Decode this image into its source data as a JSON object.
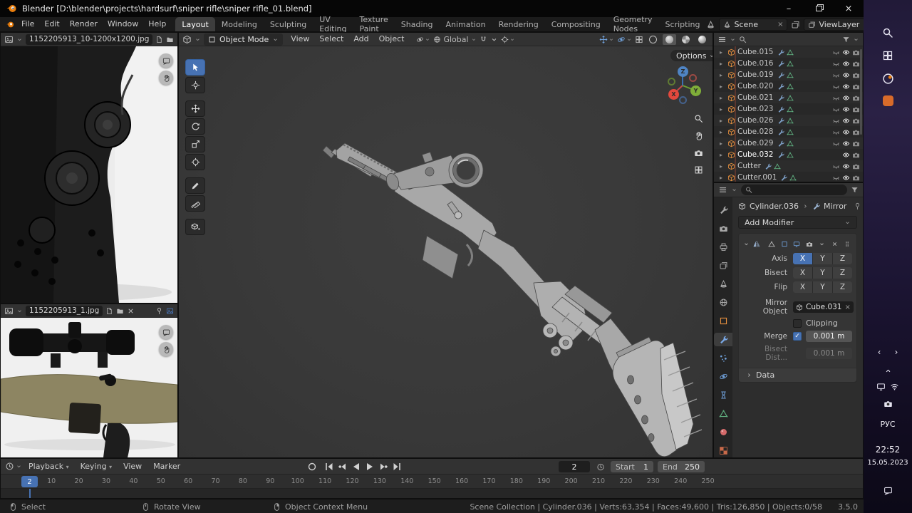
{
  "titlebar": {
    "title": "Blender [D:\\blender\\projects\\hardsurf\\sniper rifle\\sniper rifle_01.blend]"
  },
  "topbar": {
    "menus": [
      "File",
      "Edit",
      "Render",
      "Window",
      "Help"
    ],
    "workspaces": [
      {
        "label": "Layout",
        "cls": "active"
      },
      {
        "label": "Modeling"
      },
      {
        "label": "Sculpting"
      },
      {
        "label": "UV Editing"
      },
      {
        "label": "Texture Paint"
      },
      {
        "label": "Shading"
      },
      {
        "label": "Animation"
      },
      {
        "label": "Rendering"
      },
      {
        "label": "Compositing"
      },
      {
        "label": "Geometry Nodes"
      },
      {
        "label": "Scripting"
      }
    ],
    "scene": "Scene",
    "view_layer": "ViewLayer"
  },
  "image_editor_top": {
    "filename": "1152205913_10-1200x1200.jpg"
  },
  "image_editor_bottom": {
    "filename": "1152205913_1.jpg"
  },
  "viewport": {
    "mode": "Object Mode",
    "menus": [
      "View",
      "Select",
      "Add",
      "Object"
    ],
    "orientation": "Global",
    "options_label": "Options",
    "gizmo": {
      "x": "X",
      "y": "Y",
      "z": "Z"
    },
    "tools": [
      "select-box",
      "cursor",
      "move",
      "rotate",
      "scale",
      "transform",
      "annotate",
      "measure",
      "add-cube"
    ]
  },
  "outliner": {
    "items": [
      {
        "name": "Cube.015"
      },
      {
        "name": "Cube.016"
      },
      {
        "name": "Cube.019"
      },
      {
        "name": "Cube.020"
      },
      {
        "name": "Cube.021"
      },
      {
        "name": "Cube.023"
      },
      {
        "name": "Cube.026"
      },
      {
        "name": "Cube.028"
      },
      {
        "name": "Cube.029"
      },
      {
        "name": "Cube.032",
        "cls": "active"
      },
      {
        "name": "Cutter"
      },
      {
        "name": "Cutter.001"
      }
    ]
  },
  "properties": {
    "object_name": "Cylinder.036",
    "modifier_name": "Mirror",
    "add_modifier_label": "Add Modifier",
    "axis_label": "Axis",
    "bisect_label": "Bisect",
    "flip_label": "Flip",
    "axis_buttons": [
      "X",
      "Y",
      "Z"
    ],
    "mirror_object_label": "Mirror Object",
    "mirror_object_value": "Cube.031",
    "clipping_label": "Clipping",
    "merge_label": "Merge",
    "merge_value": "0.001 m",
    "bisect_dist_label": "Bisect Dist...",
    "bisect_dist_value": "0.001 m",
    "data_label": "Data"
  },
  "timeline": {
    "playback_label": "Playback",
    "keying_label": "Keying",
    "view_label": "View",
    "marker_label": "Marker",
    "current_frame": "2",
    "start_label": "Start",
    "start_value": "1",
    "end_label": "End",
    "end_value": "250",
    "ticks": [
      "10",
      "20",
      "30",
      "40",
      "50",
      "60",
      "70",
      "80",
      "90",
      "100",
      "110",
      "120",
      "130",
      "140",
      "150",
      "160",
      "170",
      "180",
      "190",
      "200",
      "210",
      "220",
      "230",
      "240",
      "250"
    ]
  },
  "statusbar": {
    "hints": [
      {
        "label": "Select"
      },
      {
        "label": "Rotate View"
      },
      {
        "label": "Object Context Menu"
      }
    ],
    "stats": "Scene Collection | Cylinder.036 | Verts:63,354 | Faces:49,600 | Tris:126,850 | Objects:0/58",
    "version": "3.5.0"
  },
  "taskbar": {
    "lang": "РУС",
    "time": "22:52",
    "date": "15.05.2023"
  }
}
